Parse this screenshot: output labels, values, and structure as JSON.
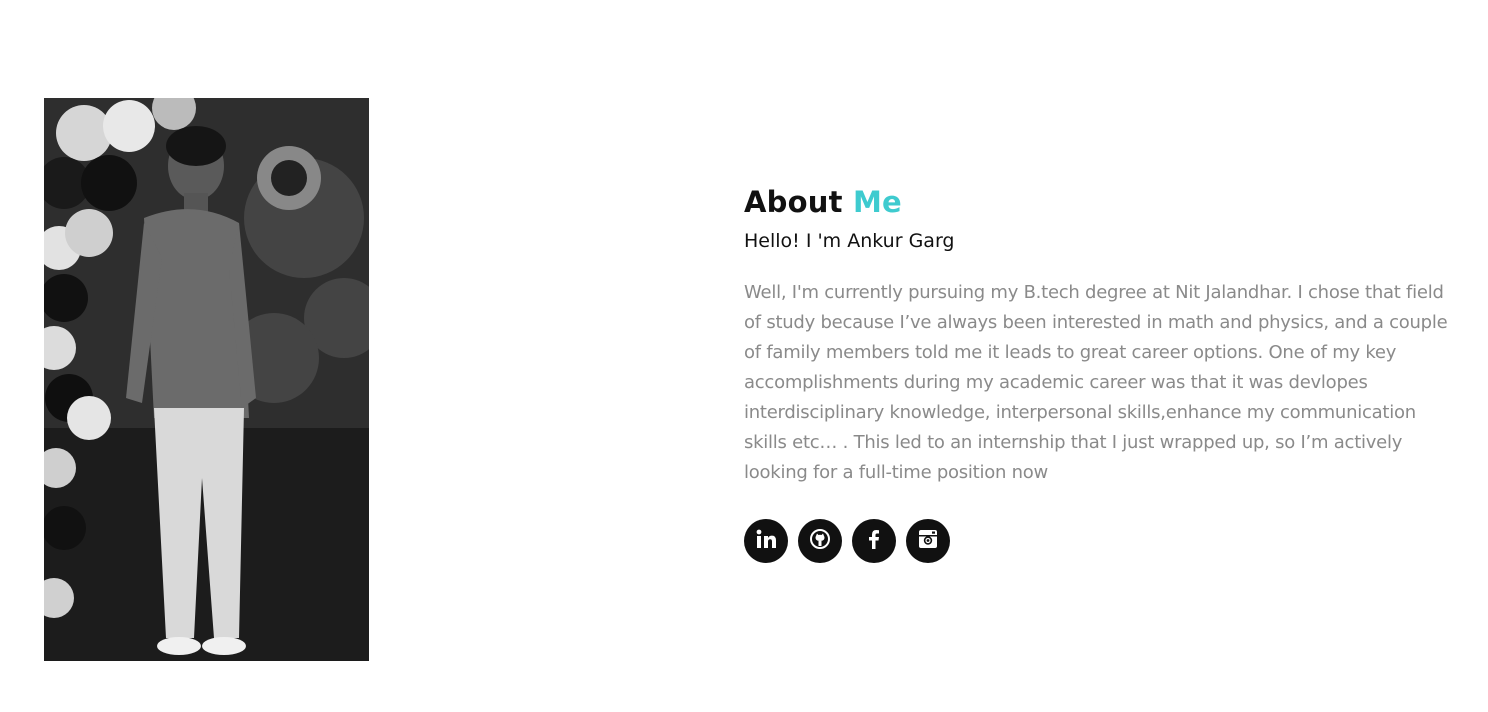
{
  "profile_photo": {
    "description_icon": "person-photo"
  },
  "about": {
    "title_main": "About",
    "title_accent": "Me",
    "greeting": "Hello! I 'm Ankur Garg",
    "bio": "Well, I'm currently pursuing my B.tech degree at Nit Jalandhar. I chose that field of study because I’ve always been interested in math and physics, and a couple of family members told me it leads to great career options. One of my key accomplishments during my academic career was that it was devlopes interdisciplinary knowledge, interpersonal skills,enhance my communication skills etc… . This led to an internship that I just wrapped up, so I’m actively looking for a full-time position now"
  },
  "social": [
    {
      "name": "linkedin",
      "icon": "linkedin-icon"
    },
    {
      "name": "github",
      "icon": "github-icon"
    },
    {
      "name": "facebook",
      "icon": "facebook-icon"
    },
    {
      "name": "instagram",
      "icon": "instagram-icon"
    }
  ],
  "colors": {
    "accent": "#3ecbcf",
    "heading": "#111111",
    "body_text": "#8a8a8a",
    "social_bg": "#111111"
  }
}
